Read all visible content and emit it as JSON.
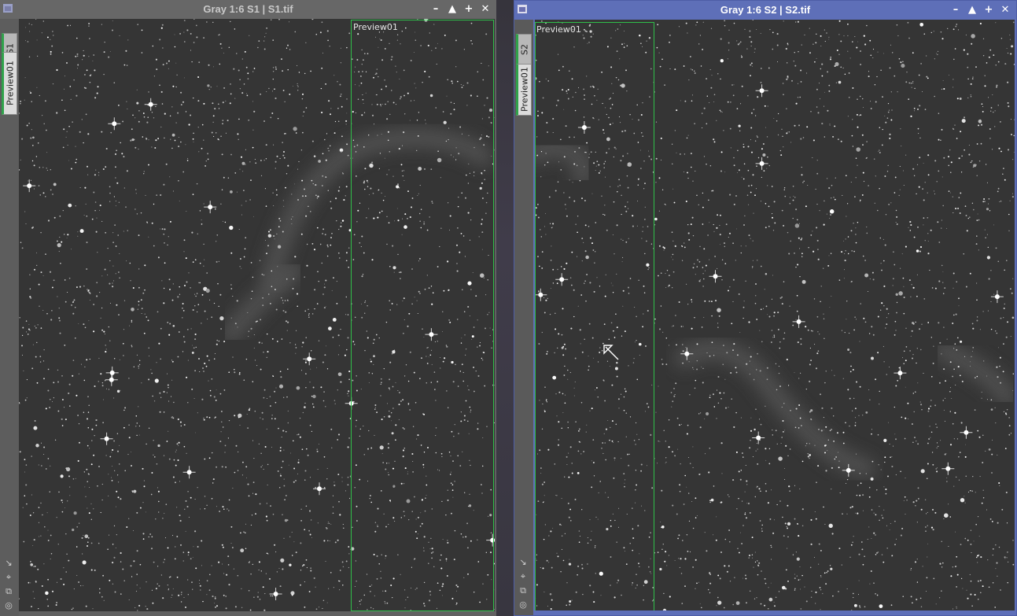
{
  "windows": [
    {
      "id": "left",
      "title": "Gray 1:6 S1 | S1.tif",
      "tabs": [
        "S1",
        "Preview01"
      ],
      "preview_label": "Preview01",
      "active": false
    },
    {
      "id": "right",
      "title": "Gray 1:6 S2 | S2.tif",
      "tabs": [
        "S2",
        "Preview01"
      ],
      "preview_label": "Preview01",
      "active": true
    }
  ],
  "titlebar_buttons": {
    "minimize": "minimize-icon",
    "shade": "shade-icon",
    "maximize": "maximize-icon",
    "close": "close-icon"
  },
  "side_icons": [
    "zoom-to-fit-icon",
    "fit-view-icon",
    "clone-icon",
    "mask-icon"
  ],
  "colors": {
    "preview_border": "#2fbf4a",
    "active_title": "#5e6fb8",
    "inactive_title": "#676767",
    "sky": "#353535"
  }
}
